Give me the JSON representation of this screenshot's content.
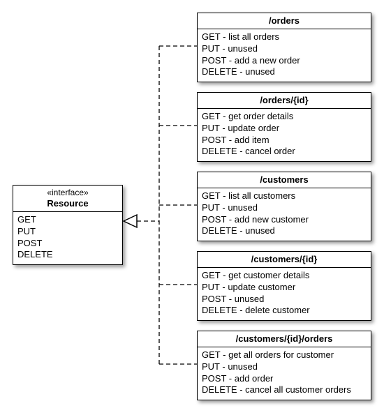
{
  "interface": {
    "stereotype": "«interface»",
    "name": "Resource",
    "operations": [
      "GET",
      "PUT",
      "POST",
      "DELETE"
    ]
  },
  "resources": [
    {
      "title": "/orders",
      "methods": [
        {
          "verb": "GET",
          "desc": "list all orders"
        },
        {
          "verb": "PUT",
          "desc": "unused"
        },
        {
          "verb": "POST",
          "desc": "add a new order"
        },
        {
          "verb": "DELETE",
          "desc": " unused"
        }
      ]
    },
    {
      "title": "/orders/{id}",
      "methods": [
        {
          "verb": "GET",
          "desc": "get order details"
        },
        {
          "verb": "PUT",
          "desc": "update order"
        },
        {
          "verb": "POST",
          "desc": "add item"
        },
        {
          "verb": "DELETE",
          "desc": "cancel order"
        }
      ]
    },
    {
      "title": "/customers",
      "methods": [
        {
          "verb": "GET",
          "desc": "list all customers"
        },
        {
          "verb": "PUT",
          "desc": "unused"
        },
        {
          "verb": "POST",
          "desc": "add new customer"
        },
        {
          "verb": "DELETE",
          "desc": "unused"
        }
      ]
    },
    {
      "title": "/customers/{id}",
      "methods": [
        {
          "verb": "GET",
          "desc": "get customer details"
        },
        {
          "verb": "PUT",
          "desc": "update customer"
        },
        {
          "verb": "POST",
          "desc": "unused"
        },
        {
          "verb": "DELETE",
          "desc": "delete customer"
        }
      ]
    },
    {
      "title": "/customers/{id}/orders",
      "methods": [
        {
          "verb": "GET",
          "desc": "get all orders for customer"
        },
        {
          "verb": "PUT",
          "desc": "unused"
        },
        {
          "verb": "POST",
          "desc": "add order"
        },
        {
          "verb": "DELETE",
          "desc": "cancel all customer orders"
        }
      ]
    }
  ]
}
